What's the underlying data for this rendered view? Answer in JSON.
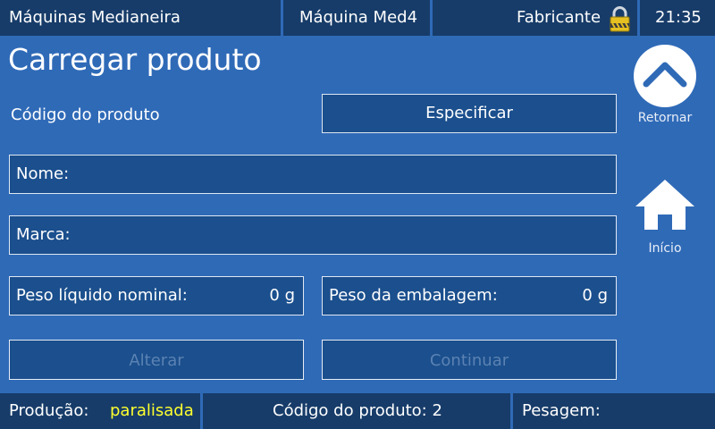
{
  "header": {
    "app_name": "Máquinas Medianeira",
    "machine": "Máquina Med4",
    "user": "Fabricante",
    "time": "21:35"
  },
  "page": {
    "title": "Carregar produto"
  },
  "form": {
    "product_code_label": "Código do produto",
    "specify_button": "Especificar",
    "name_label": "Nome:",
    "brand_label": "Marca:",
    "net_weight_label": "Peso líquido nominal:",
    "net_weight_value": "0 g",
    "package_weight_label": "Peso da embalagem:",
    "package_weight_value": "0 g",
    "alter_button": "Alterar",
    "continue_button": "Continuar"
  },
  "side": {
    "back_label": "Retornar",
    "home_label": "Início"
  },
  "footer": {
    "production_label": "Produção:",
    "production_status": "paralisada",
    "product_code": "Código do produto: 2",
    "weighing_label": "Pesagem:"
  },
  "icons": {
    "lock": "lock-icon",
    "back": "chevron-up-icon",
    "home": "home-icon"
  },
  "colors": {
    "background": "#2f6ab7",
    "bar": "#173c69",
    "field": "#1b4f8d",
    "status_stopped": "#ffff2e"
  }
}
